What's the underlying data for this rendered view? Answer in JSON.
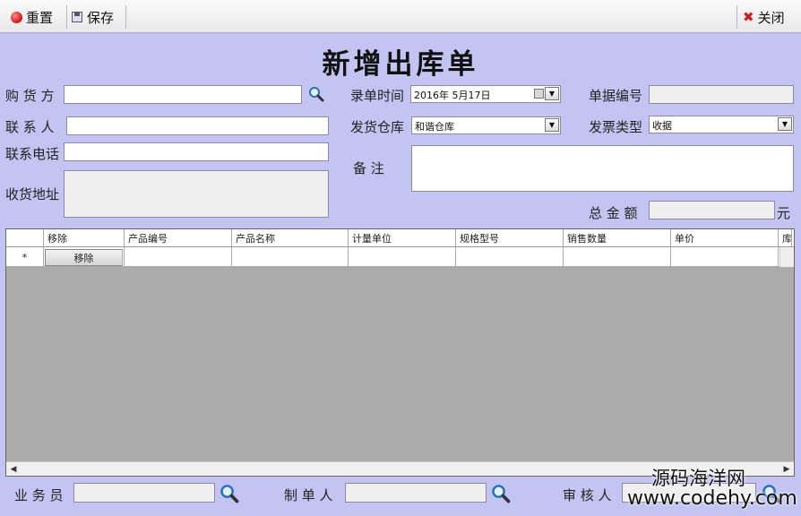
{
  "toolbar": {
    "reset_label": "重置",
    "save_label": "保存",
    "close_label": "关闭"
  },
  "page_title": "新增出库单",
  "form": {
    "buyer_label": "购 货 方",
    "buyer_value": "",
    "contact_label": "联 系 人",
    "contact_value": "",
    "phone_label": "联系电话",
    "phone_value": "",
    "address_label": "收货地址",
    "address_value": "",
    "entry_time_label": "录单时间",
    "entry_time_value": "2016年  5月17日",
    "warehouse_label": "发货仓库",
    "warehouse_value": "和谐仓库",
    "remark_label": "备    注",
    "remark_value": "",
    "doc_no_label": "单据编号",
    "doc_no_value": "",
    "invoice_type_label": "发票类型",
    "invoice_type_value": "收据",
    "total_label": "总 金 额",
    "total_value": "",
    "currency_unit": "元"
  },
  "grid": {
    "columns": [
      "",
      "移除",
      "产品编号",
      "产品名称",
      "计量单位",
      "规格型号",
      "销售数量",
      "单价",
      "库"
    ],
    "new_row_marker": "*",
    "remove_button_label": "移除"
  },
  "footer": {
    "salesperson_label": "业 务 员",
    "salesperson_value": "",
    "maker_label": "制 单 人",
    "maker_value": "",
    "reviewer_label": "审 核 人",
    "reviewer_value": ""
  },
  "watermark": {
    "line1": "源码海洋网",
    "line2": "www.codehy.com"
  },
  "icons": [
    "reset-icon",
    "save-icon",
    "close-icon",
    "search-icon",
    "calendar-icon",
    "chevron-down-icon"
  ],
  "colors": {
    "background": "#c4c4f2",
    "reset_icon": "#d21414",
    "close_icon": "#c82020"
  }
}
